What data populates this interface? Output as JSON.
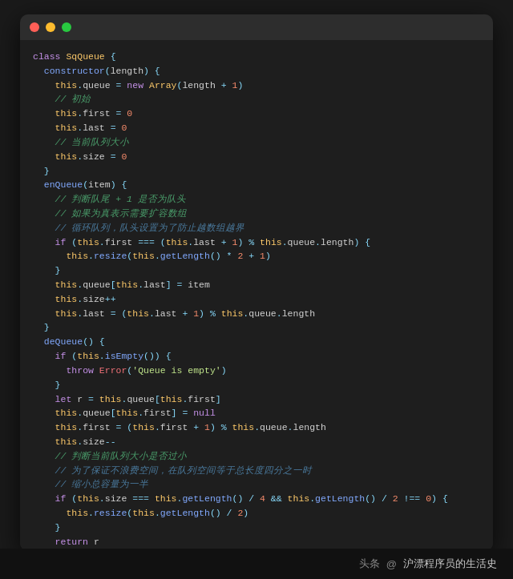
{
  "window": {
    "titlebar": {
      "dot_red": "red",
      "dot_yellow": "yellow",
      "dot_green": "green"
    }
  },
  "footer": {
    "platform": "头条",
    "author": "沪漂程序员的生活史"
  }
}
